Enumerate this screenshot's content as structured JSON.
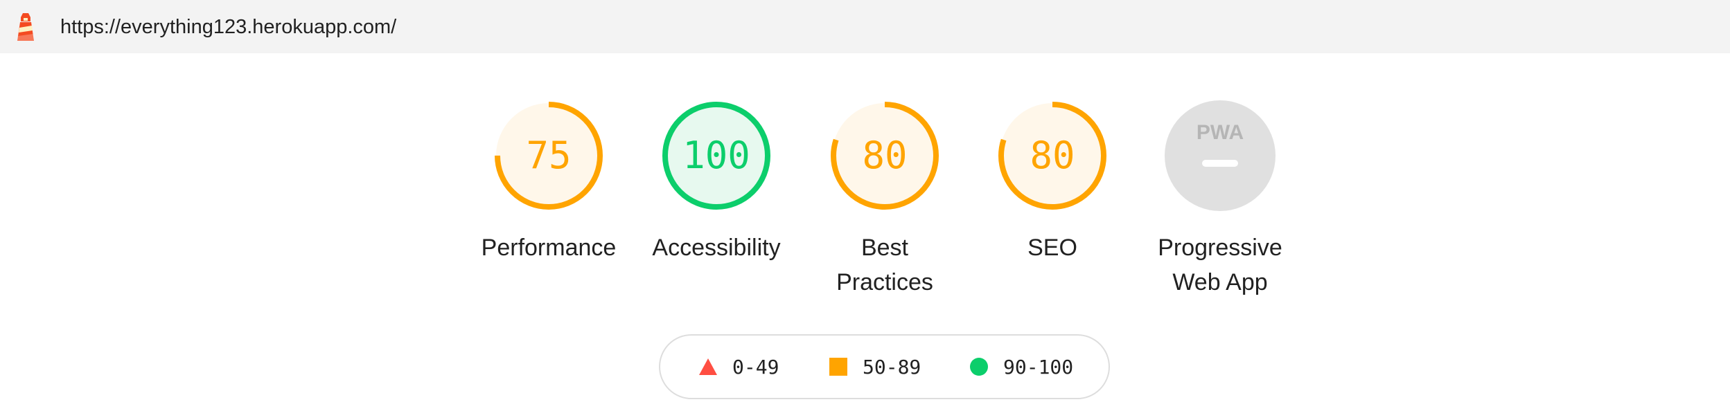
{
  "address_bar": {
    "url": "https://everything123.herokuapp.com/",
    "logo_icon": "lighthouse-icon"
  },
  "categories": [
    {
      "id": "performance",
      "label_lines": [
        "Performance"
      ],
      "score": 75,
      "status": "average",
      "color": "#ffa400",
      "fill": "#fff7ea"
    },
    {
      "id": "accessibility",
      "label_lines": [
        "Accessibility"
      ],
      "score": 100,
      "status": "pass",
      "color": "#0cce6b",
      "fill": "#e7f9ef"
    },
    {
      "id": "best-practices",
      "label_lines": [
        "Best",
        "Practices"
      ],
      "score": 80,
      "status": "average",
      "color": "#ffa400",
      "fill": "#fff7ea"
    },
    {
      "id": "seo",
      "label_lines": [
        "SEO"
      ],
      "score": 80,
      "status": "average",
      "color": "#ffa400",
      "fill": "#fff7ea"
    },
    {
      "id": "pwa",
      "label_lines": [
        "Progressive",
        "Web App"
      ],
      "badge_text": "PWA",
      "status": "na",
      "color": "#e0e0e0"
    }
  ],
  "legend": [
    {
      "range": "0-49",
      "shape": "triangle-icon",
      "color": "#ff4e42"
    },
    {
      "range": "50-89",
      "shape": "square-icon",
      "color": "#ffa400"
    },
    {
      "range": "90-100",
      "shape": "circle-icon",
      "color": "#0cce6b"
    }
  ]
}
